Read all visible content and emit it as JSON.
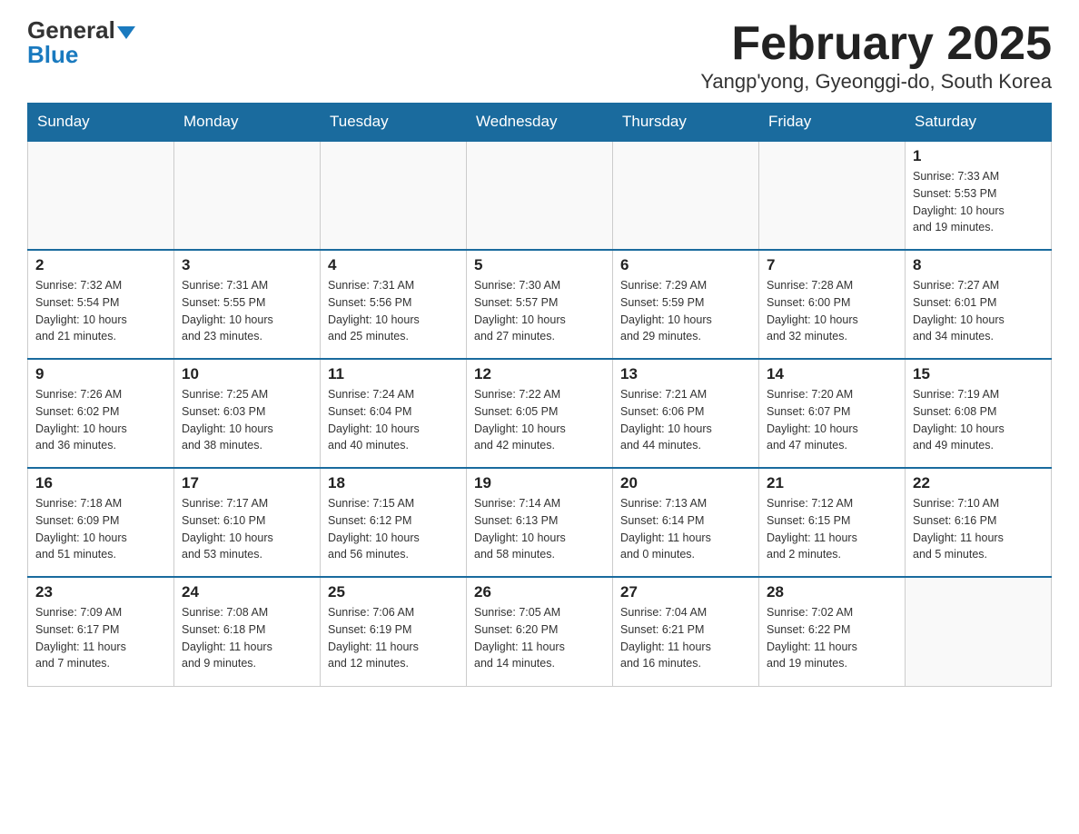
{
  "logo": {
    "general": "General",
    "blue": "Blue"
  },
  "title": "February 2025",
  "subtitle": "Yangp'yong, Gyeonggi-do, South Korea",
  "headers": [
    "Sunday",
    "Monday",
    "Tuesday",
    "Wednesday",
    "Thursday",
    "Friday",
    "Saturday"
  ],
  "weeks": [
    [
      {
        "day": "",
        "info": ""
      },
      {
        "day": "",
        "info": ""
      },
      {
        "day": "",
        "info": ""
      },
      {
        "day": "",
        "info": ""
      },
      {
        "day": "",
        "info": ""
      },
      {
        "day": "",
        "info": ""
      },
      {
        "day": "1",
        "info": "Sunrise: 7:33 AM\nSunset: 5:53 PM\nDaylight: 10 hours\nand 19 minutes."
      }
    ],
    [
      {
        "day": "2",
        "info": "Sunrise: 7:32 AM\nSunset: 5:54 PM\nDaylight: 10 hours\nand 21 minutes."
      },
      {
        "day": "3",
        "info": "Sunrise: 7:31 AM\nSunset: 5:55 PM\nDaylight: 10 hours\nand 23 minutes."
      },
      {
        "day": "4",
        "info": "Sunrise: 7:31 AM\nSunset: 5:56 PM\nDaylight: 10 hours\nand 25 minutes."
      },
      {
        "day": "5",
        "info": "Sunrise: 7:30 AM\nSunset: 5:57 PM\nDaylight: 10 hours\nand 27 minutes."
      },
      {
        "day": "6",
        "info": "Sunrise: 7:29 AM\nSunset: 5:59 PM\nDaylight: 10 hours\nand 29 minutes."
      },
      {
        "day": "7",
        "info": "Sunrise: 7:28 AM\nSunset: 6:00 PM\nDaylight: 10 hours\nand 32 minutes."
      },
      {
        "day": "8",
        "info": "Sunrise: 7:27 AM\nSunset: 6:01 PM\nDaylight: 10 hours\nand 34 minutes."
      }
    ],
    [
      {
        "day": "9",
        "info": "Sunrise: 7:26 AM\nSunset: 6:02 PM\nDaylight: 10 hours\nand 36 minutes."
      },
      {
        "day": "10",
        "info": "Sunrise: 7:25 AM\nSunset: 6:03 PM\nDaylight: 10 hours\nand 38 minutes."
      },
      {
        "day": "11",
        "info": "Sunrise: 7:24 AM\nSunset: 6:04 PM\nDaylight: 10 hours\nand 40 minutes."
      },
      {
        "day": "12",
        "info": "Sunrise: 7:22 AM\nSunset: 6:05 PM\nDaylight: 10 hours\nand 42 minutes."
      },
      {
        "day": "13",
        "info": "Sunrise: 7:21 AM\nSunset: 6:06 PM\nDaylight: 10 hours\nand 44 minutes."
      },
      {
        "day": "14",
        "info": "Sunrise: 7:20 AM\nSunset: 6:07 PM\nDaylight: 10 hours\nand 47 minutes."
      },
      {
        "day": "15",
        "info": "Sunrise: 7:19 AM\nSunset: 6:08 PM\nDaylight: 10 hours\nand 49 minutes."
      }
    ],
    [
      {
        "day": "16",
        "info": "Sunrise: 7:18 AM\nSunset: 6:09 PM\nDaylight: 10 hours\nand 51 minutes."
      },
      {
        "day": "17",
        "info": "Sunrise: 7:17 AM\nSunset: 6:10 PM\nDaylight: 10 hours\nand 53 minutes."
      },
      {
        "day": "18",
        "info": "Sunrise: 7:15 AM\nSunset: 6:12 PM\nDaylight: 10 hours\nand 56 minutes."
      },
      {
        "day": "19",
        "info": "Sunrise: 7:14 AM\nSunset: 6:13 PM\nDaylight: 10 hours\nand 58 minutes."
      },
      {
        "day": "20",
        "info": "Sunrise: 7:13 AM\nSunset: 6:14 PM\nDaylight: 11 hours\nand 0 minutes."
      },
      {
        "day": "21",
        "info": "Sunrise: 7:12 AM\nSunset: 6:15 PM\nDaylight: 11 hours\nand 2 minutes."
      },
      {
        "day": "22",
        "info": "Sunrise: 7:10 AM\nSunset: 6:16 PM\nDaylight: 11 hours\nand 5 minutes."
      }
    ],
    [
      {
        "day": "23",
        "info": "Sunrise: 7:09 AM\nSunset: 6:17 PM\nDaylight: 11 hours\nand 7 minutes."
      },
      {
        "day": "24",
        "info": "Sunrise: 7:08 AM\nSunset: 6:18 PM\nDaylight: 11 hours\nand 9 minutes."
      },
      {
        "day": "25",
        "info": "Sunrise: 7:06 AM\nSunset: 6:19 PM\nDaylight: 11 hours\nand 12 minutes."
      },
      {
        "day": "26",
        "info": "Sunrise: 7:05 AM\nSunset: 6:20 PM\nDaylight: 11 hours\nand 14 minutes."
      },
      {
        "day": "27",
        "info": "Sunrise: 7:04 AM\nSunset: 6:21 PM\nDaylight: 11 hours\nand 16 minutes."
      },
      {
        "day": "28",
        "info": "Sunrise: 7:02 AM\nSunset: 6:22 PM\nDaylight: 11 hours\nand 19 minutes."
      },
      {
        "day": "",
        "info": ""
      }
    ]
  ]
}
